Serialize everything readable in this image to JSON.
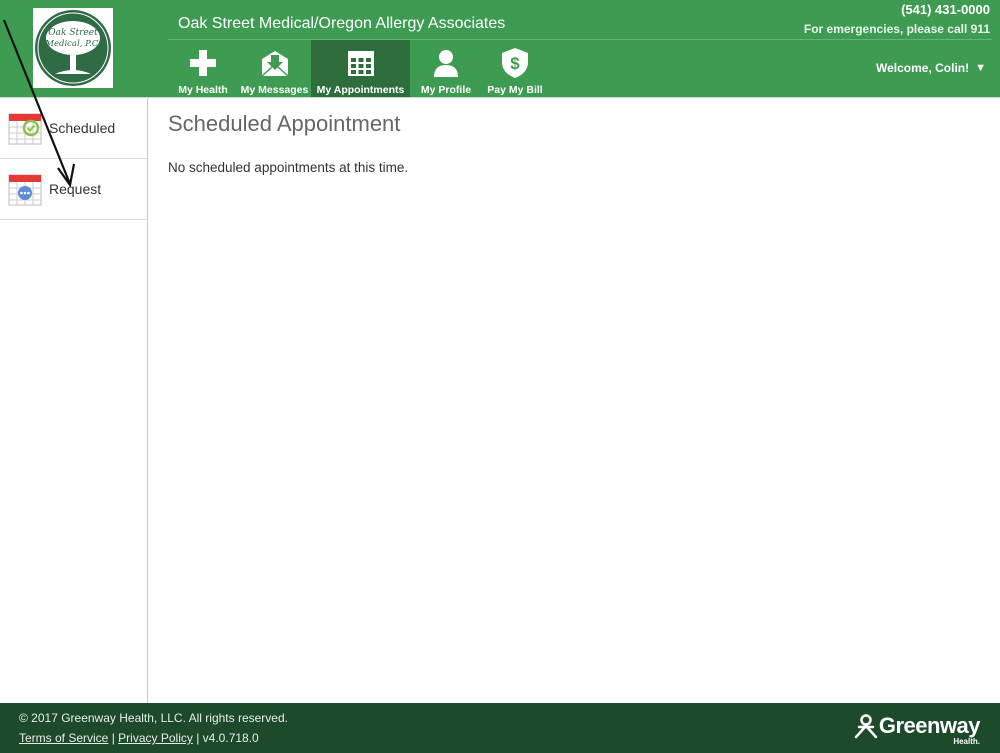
{
  "header": {
    "practice_name": "Oak Street Medical/Oregon Allergy Associates",
    "phone": "(541) 431-0000",
    "emergency": "For emergencies, please call 911",
    "welcome": "Welcome, Colin!",
    "logo_line1": "Oak Street",
    "logo_line2": "Medical, P.C."
  },
  "nav": {
    "items": [
      {
        "label": "My Health",
        "icon": "plus-icon"
      },
      {
        "label": "My Messages",
        "icon": "inbox-icon"
      },
      {
        "label": "My Appointments",
        "icon": "calendar-icon",
        "active": true
      },
      {
        "label": "My Profile",
        "icon": "person-icon"
      },
      {
        "label": "Pay My Bill",
        "icon": "dollar-shield-icon"
      }
    ]
  },
  "sidebar": {
    "items": [
      {
        "label": "Scheduled",
        "icon": "calendar-check-icon"
      },
      {
        "label": "Request",
        "icon": "calendar-request-icon"
      }
    ]
  },
  "main": {
    "title": "Scheduled Appointment",
    "empty_message": "No scheduled appointments at this time."
  },
  "footer": {
    "copyright": "© 2017 Greenway Health, LLC. All rights reserved.",
    "terms": "Terms of Service",
    "privacy": "Privacy Policy",
    "separator": "|",
    "version": "v4.0.718.0",
    "brand": "Greenway",
    "brand_sub": "Health."
  },
  "colors": {
    "header_green": "#3e9b52",
    "active_tab": "#2d6e3c",
    "footer_green": "#1e4a2c",
    "calendar_red": "#e53935"
  }
}
